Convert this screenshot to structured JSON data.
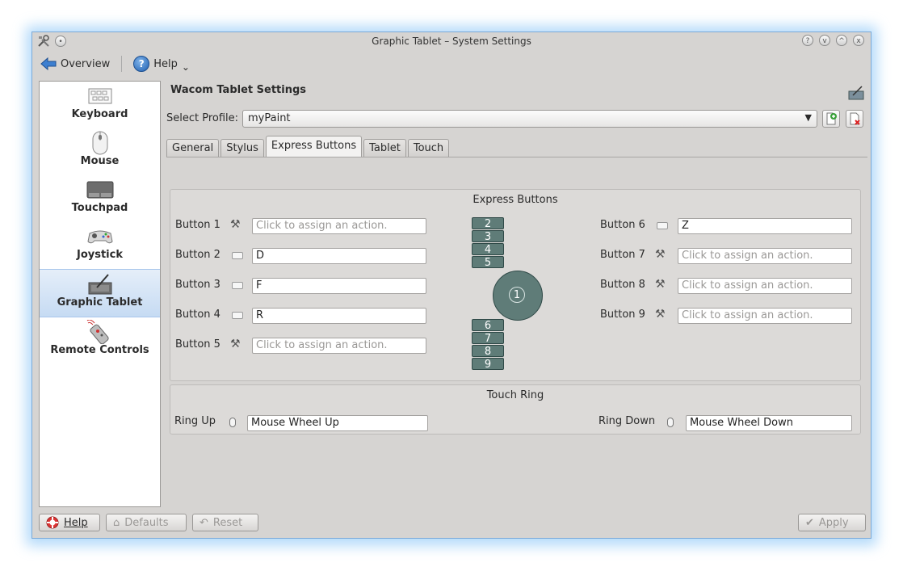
{
  "window": {
    "title": "Graphic Tablet – System Settings",
    "controls": [
      "?",
      "v",
      "^",
      "x"
    ]
  },
  "toolbar": {
    "overview_label": "Overview",
    "help_label": "Help",
    "help_arrow": "⌄"
  },
  "sidebar": {
    "items": [
      {
        "label": "Keyboard",
        "icon": "keyboard-icon"
      },
      {
        "label": "Mouse",
        "icon": "mouse-icon"
      },
      {
        "label": "Touchpad",
        "icon": "touchpad-icon"
      },
      {
        "label": "Joystick",
        "icon": "joystick-icon"
      },
      {
        "label": "Graphic Tablet",
        "icon": "graphic-tablet-icon",
        "selected": true
      },
      {
        "label": "Remote Controls",
        "icon": "remote-control-icon"
      }
    ]
  },
  "page": {
    "title": "Wacom Tablet Settings",
    "profile_label": "Select Profile:",
    "profile_value": "myPaint",
    "tabs": [
      {
        "label": "General",
        "active": false
      },
      {
        "label": "Stylus",
        "active": false
      },
      {
        "label": "Express Buttons",
        "active": true
      },
      {
        "label": "Tablet",
        "active": false
      },
      {
        "label": "Touch",
        "active": false
      }
    ]
  },
  "express": {
    "title": "Express Buttons",
    "placeholder": "Click to assign an action.",
    "left": [
      {
        "label": "Button 1",
        "value": "",
        "icon": "wrench"
      },
      {
        "label": "Button 2",
        "value": "D",
        "icon": "keyboard"
      },
      {
        "label": "Button 3",
        "value": "F",
        "icon": "keyboard"
      },
      {
        "label": "Button 4",
        "value": "R",
        "icon": "keyboard"
      },
      {
        "label": "Button 5",
        "value": "",
        "icon": "wrench"
      }
    ],
    "right": [
      {
        "label": "Button 6",
        "value": "Z",
        "icon": "keyboard"
      },
      {
        "label": "Button 7",
        "value": "",
        "icon": "wrench"
      },
      {
        "label": "Button 8",
        "value": "",
        "icon": "wrench"
      },
      {
        "label": "Button 9",
        "value": "",
        "icon": "wrench"
      }
    ],
    "pad_top": [
      "2",
      "3",
      "4",
      "5"
    ],
    "pad_ring": "1",
    "pad_bottom": [
      "6",
      "7",
      "8",
      "9"
    ]
  },
  "touch_ring": {
    "title": "Touch Ring",
    "up_label": "Ring Up",
    "up_value": "Mouse Wheel Up",
    "down_label": "Ring Down",
    "down_value": "Mouse Wheel Down"
  },
  "footer": {
    "help": "Help",
    "defaults": "Defaults",
    "reset": "Reset",
    "apply": "Apply"
  },
  "colors": {
    "accent": "#1f5fb0",
    "pad": "#5f7c78"
  }
}
